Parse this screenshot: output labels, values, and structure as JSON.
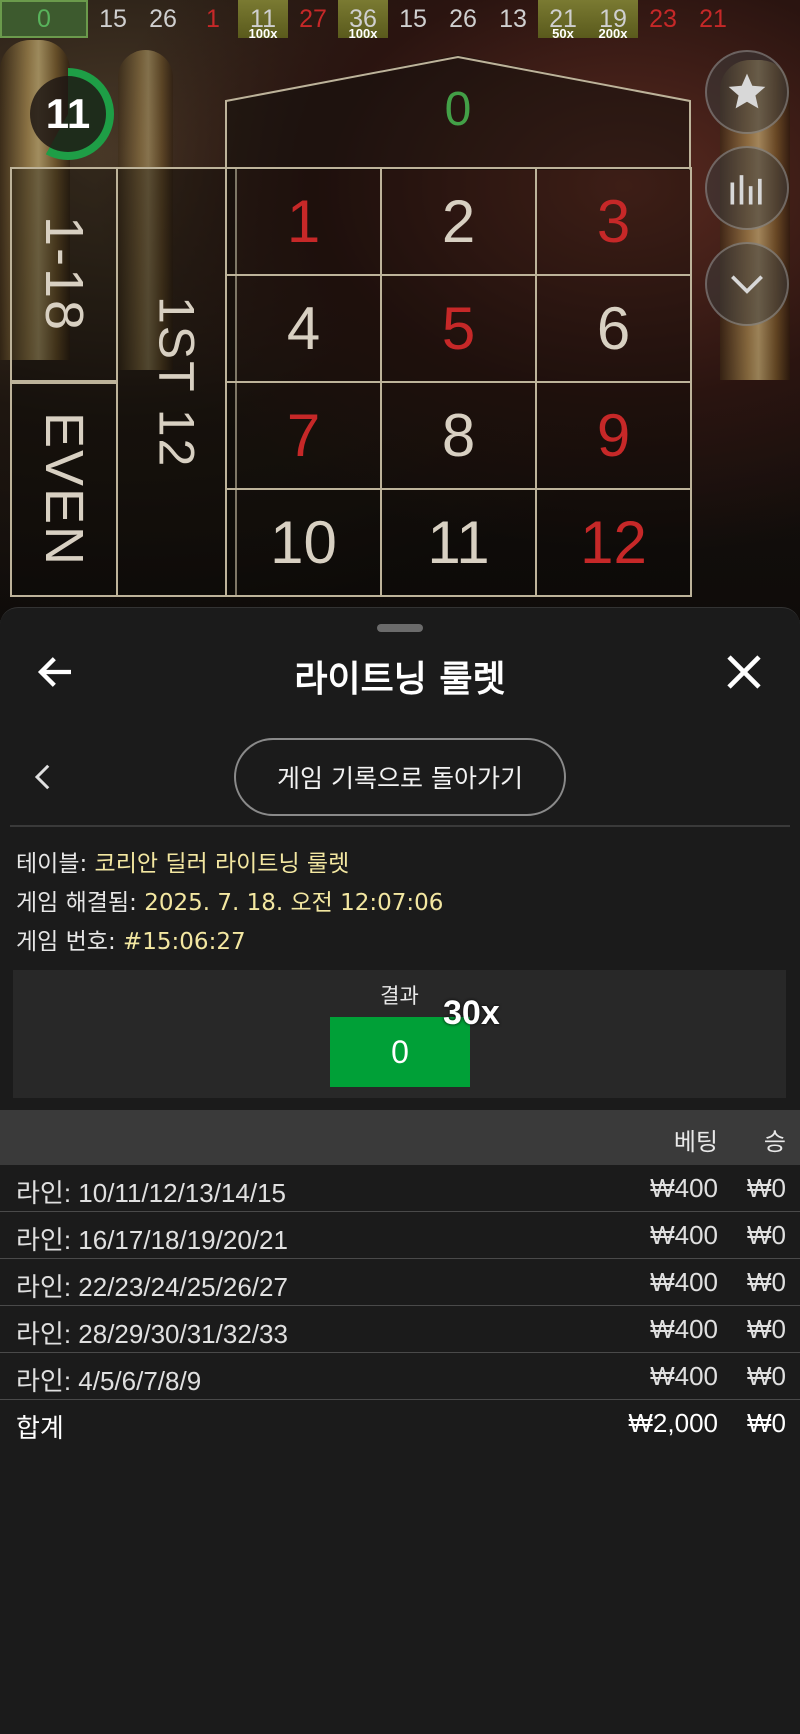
{
  "history": [
    {
      "value": "0",
      "color": "green",
      "mult": ""
    },
    {
      "value": "15",
      "color": "black",
      "mult": ""
    },
    {
      "value": "26",
      "color": "black",
      "mult": ""
    },
    {
      "value": "1",
      "color": "red",
      "mult": ""
    },
    {
      "value": "11",
      "color": "gold",
      "mult": "100x"
    },
    {
      "value": "27",
      "color": "red",
      "mult": ""
    },
    {
      "value": "36",
      "color": "gold",
      "mult": "100x"
    },
    {
      "value": "15",
      "color": "black",
      "mult": ""
    },
    {
      "value": "26",
      "color": "black",
      "mult": ""
    },
    {
      "value": "13",
      "color": "black",
      "mult": ""
    },
    {
      "value": "21",
      "color": "gold",
      "mult": "50x"
    },
    {
      "value": "19",
      "color": "gold",
      "mult": "200x"
    },
    {
      "value": "23",
      "color": "red",
      "mult": ""
    },
    {
      "value": "21",
      "color": "red",
      "mult": ""
    }
  ],
  "timer": "11",
  "board": {
    "zero": "0",
    "outside": {
      "low": "1-18",
      "dozen": "1ST 12",
      "even": "EVEN"
    },
    "numbers": [
      {
        "n": "1",
        "red": true
      },
      {
        "n": "2",
        "red": false
      },
      {
        "n": "3",
        "red": true
      },
      {
        "n": "4",
        "red": false
      },
      {
        "n": "5",
        "red": true
      },
      {
        "n": "6",
        "red": false
      },
      {
        "n": "7",
        "red": true
      },
      {
        "n": "8",
        "red": false
      },
      {
        "n": "9",
        "red": true
      },
      {
        "n": "10",
        "red": false
      },
      {
        "n": "11",
        "red": false
      },
      {
        "n": "12",
        "red": true
      }
    ]
  },
  "sheet": {
    "title": "라이트닝 룰렛",
    "history_button": "게임 기록으로 돌아가기",
    "table_label": "테이블:",
    "table_value": "코리안 딜러 라이트닝 룰렛",
    "resolved_label": "게임 해결됨:",
    "resolved_value": "2025. 7. 18. 오전 12:07:06",
    "game_no_label": "게임 번호:",
    "game_no_value": "#15:06:27",
    "result_label": "결과",
    "result_value": "0",
    "result_mult": "30x"
  },
  "bets": {
    "header_bet": "베팅",
    "header_win": "승",
    "rows": [
      {
        "desc": "라인: 10/11/12/13/14/15",
        "amount": "₩400",
        "win": "₩0"
      },
      {
        "desc": "라인: 16/17/18/19/20/21",
        "amount": "₩400",
        "win": "₩0"
      },
      {
        "desc": "라인: 22/23/24/25/26/27",
        "amount": "₩400",
        "win": "₩0"
      },
      {
        "desc": "라인: 28/29/30/31/32/33",
        "amount": "₩400",
        "win": "₩0"
      },
      {
        "desc": "라인: 4/5/6/7/8/9",
        "amount": "₩400",
        "win": "₩0"
      }
    ],
    "total_label": "합계",
    "total_amount": "₩2,000",
    "total_win": "₩0"
  },
  "colors": {
    "accent_green": "#00a037",
    "red_number": "#c62828",
    "info_value": "#f3e7a1"
  },
  "icons": [
    "star-icon",
    "stats-icon",
    "chevron-down-icon",
    "back-arrow-icon",
    "close-icon",
    "chevron-left-icon"
  ]
}
